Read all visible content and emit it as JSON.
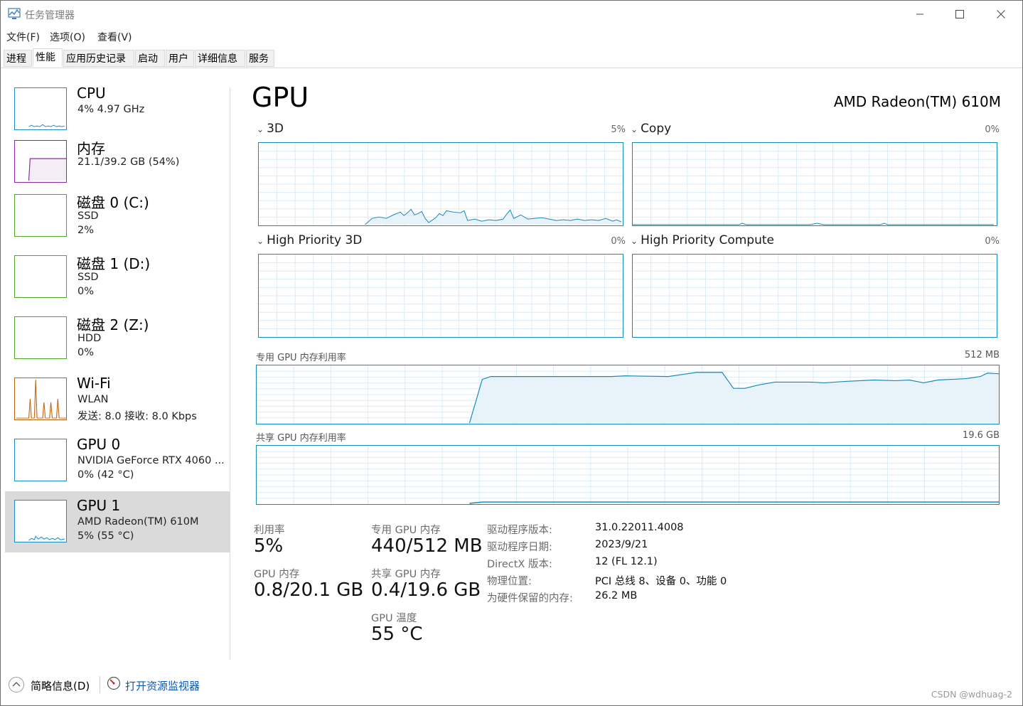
{
  "window": {
    "title": "任务管理器",
    "buttons": [
      "minimize-button",
      "maximize-button",
      "close-button"
    ]
  },
  "menu": [
    "文件(F)",
    "选项(O)",
    "查看(V)"
  ],
  "tabs": [
    {
      "label": "进程",
      "active": false
    },
    {
      "label": "性能",
      "active": true
    },
    {
      "label": "应用历史记录",
      "active": false
    },
    {
      "label": "启动",
      "active": false
    },
    {
      "label": "用户",
      "active": false
    },
    {
      "label": "详细信息",
      "active": false
    },
    {
      "label": "服务",
      "active": false
    }
  ],
  "sidebar": [
    {
      "name": "CPU",
      "line1": "4% 4.97 GHz",
      "line2": "",
      "color": "#1f8cc4",
      "selected": false
    },
    {
      "name": "内存",
      "line1": "21.1/39.2 GB (54%)",
      "line2": "",
      "color": "#8b2aa6",
      "selected": false
    },
    {
      "name": "磁盘 0 (C:)",
      "line1": "SSD",
      "line2": "2%",
      "color": "#4da627",
      "selected": false
    },
    {
      "name": "磁盘 1 (D:)",
      "line1": "SSD",
      "line2": "0%",
      "color": "#4da627",
      "selected": false
    },
    {
      "name": "磁盘 2 (Z:)",
      "line1": "HDD",
      "line2": "0%",
      "color": "#4da627",
      "selected": false
    },
    {
      "name": "Wi-Fi",
      "line1": "WLAN",
      "line2": "发送: 8.0 接收: 8.0 Kbps",
      "color": "#b9620d",
      "selected": false
    },
    {
      "name": "GPU 0",
      "line1": "NVIDIA GeForce RTX 4060 ...",
      "line2": "0% (42 °C)",
      "color": "#1f8cc4",
      "selected": false
    },
    {
      "name": "GPU 1",
      "line1": "AMD Radeon(TM) 610M",
      "line2": "5% (55 °C)",
      "color": "#1f8cc4",
      "selected": true
    }
  ],
  "main": {
    "title": "GPU",
    "model": "AMD Radeon(TM) 610M",
    "engines": [
      {
        "label": "3D",
        "pct": "5%"
      },
      {
        "label": "Copy",
        "pct": "0%"
      },
      {
        "label": "High Priority 3D",
        "pct": "0%"
      },
      {
        "label": "High Priority Compute",
        "pct": "0%"
      }
    ],
    "dedicated_label": "专用 GPU 内存利用率",
    "dedicated_max": "512 MB",
    "shared_label": "共享 GPU 内存利用率",
    "shared_max": "19.6 GB",
    "stats": {
      "util_label": "利用率",
      "util_value": "5%",
      "gpumem_label": "GPU 内存",
      "gpumem_value": "0.8/20.1 GB",
      "ded_label": "专用 GPU 内存",
      "ded_value": "440/512 MB",
      "shr_label": "共享 GPU 内存",
      "shr_value": "0.4/19.6 GB",
      "temp_label": "GPU 温度",
      "temp_value": "55 °C"
    },
    "properties": [
      {
        "key": "驱动程序版本:",
        "value": "31.0.22011.4008"
      },
      {
        "key": "驱动程序日期:",
        "value": "2023/9/21"
      },
      {
        "key": "DirectX 版本:",
        "value": "12 (FL 12.1)"
      },
      {
        "key": "物理位置:",
        "value": "PCI 总线 8、设备 0、功能 0"
      },
      {
        "key": "为硬件保留的内存:",
        "value": "26.2 MB"
      }
    ]
  },
  "footer": {
    "summary": "简略信息(D)",
    "resource_monitor": "打开资源监视器",
    "watermark": "CSDN @wdhuag-2"
  },
  "colors": {
    "gpu_line": "#138abd",
    "gpu_fill": "#e8f2f9",
    "link": "#0a5ab5",
    "selected_bg": "#dadada"
  }
}
